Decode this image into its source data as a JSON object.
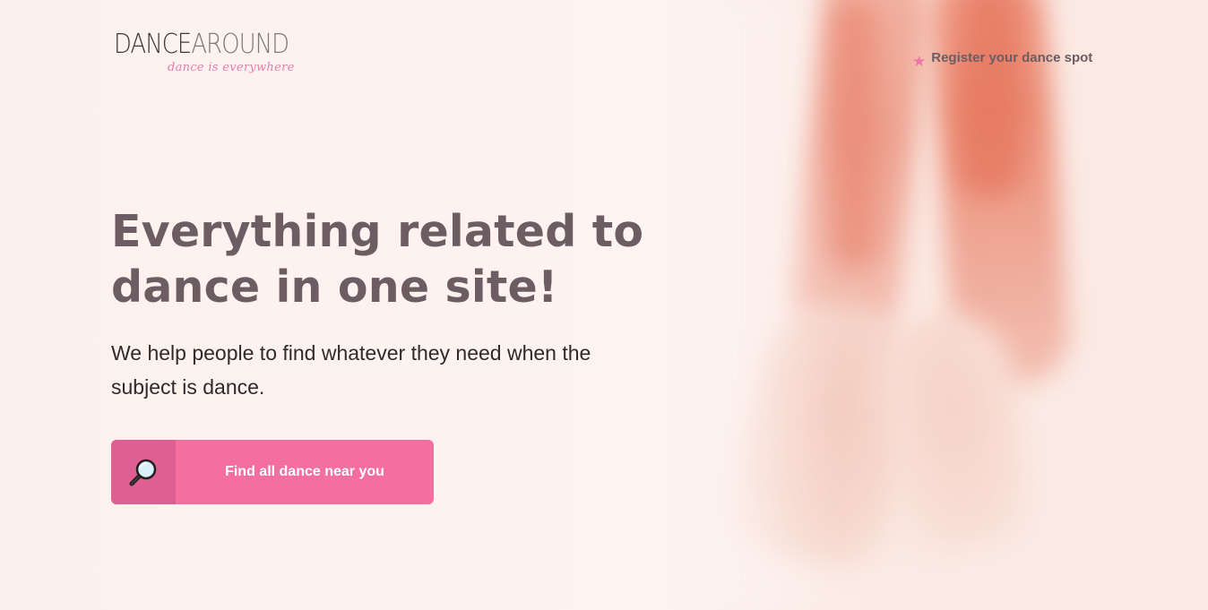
{
  "header": {
    "logo": {
      "word_dark": "DANCE",
      "word_light": "AROUND",
      "tagline": "dance is everywhere"
    },
    "register_link": {
      "icon": "star-icon",
      "label": "Register your dance spot"
    }
  },
  "hero": {
    "headline": "Everything related to dance in one site!",
    "subtext": "We help people to find whatever they need when the subject is dance.",
    "cta": {
      "icon": "magnifier-icon",
      "label": "Find all dance near you"
    }
  },
  "colors": {
    "accent_pink": "#f46f9f",
    "accent_pink_dark": "#e05f92",
    "headline_text": "#6d5d63",
    "body_text": "#2f2a2c",
    "background": "#fdf1ee"
  }
}
